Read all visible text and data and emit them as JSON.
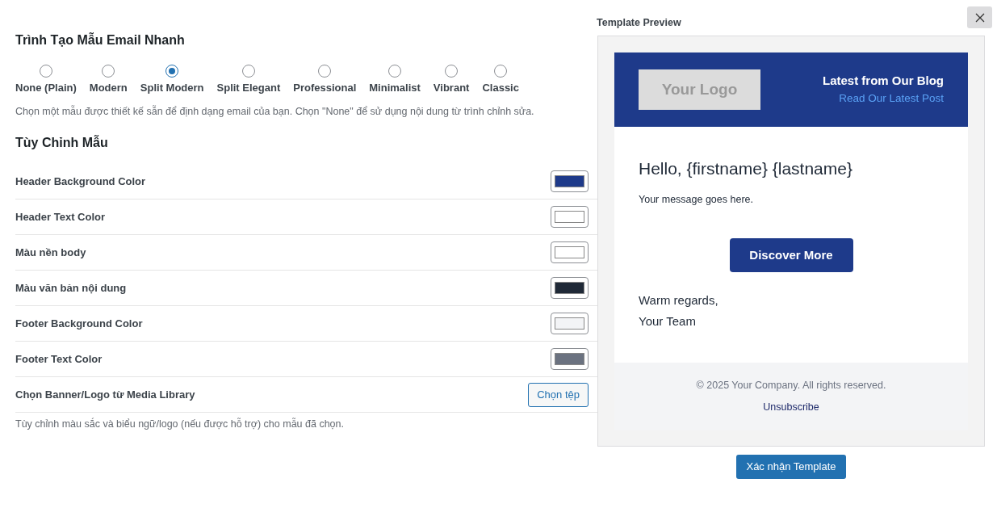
{
  "title": "Trình Tạo Mẫu Email Nhanh",
  "templates": [
    {
      "label": "None (Plain)",
      "selected": false
    },
    {
      "label": "Modern",
      "selected": false
    },
    {
      "label": "Split Modern",
      "selected": true
    },
    {
      "label": "Split Elegant",
      "selected": false
    },
    {
      "label": "Professional",
      "selected": false
    },
    {
      "label": "Minimalist",
      "selected": false
    },
    {
      "label": "Vibrant",
      "selected": false
    },
    {
      "label": "Classic",
      "selected": false
    }
  ],
  "templates_hint": "Chọn một mẫu được thiết kế sẵn để định dạng email của bạn. Chọn \"None\" để sử dụng nội dung từ trình chỉnh sửa.",
  "customize_title": "Tùy Chỉnh Mẫu",
  "settings": [
    {
      "kind": "color",
      "label": "Header Background Color",
      "color": "#1e3a8a"
    },
    {
      "kind": "color",
      "label": "Header Text Color",
      "color": "#ffffff"
    },
    {
      "kind": "color",
      "label": "Màu nền body",
      "color": "#ffffff"
    },
    {
      "kind": "color",
      "label": "Màu văn bản nội dung",
      "color": "#1f2937"
    },
    {
      "kind": "color",
      "label": "Footer Background Color",
      "color": "#f3f4f6"
    },
    {
      "kind": "color",
      "label": "Footer Text Color",
      "color": "#6b7280"
    },
    {
      "kind": "file",
      "label": "Chọn Banner/Logo từ Media Library",
      "button": "Chọn tệp"
    }
  ],
  "customize_hint": "Tùy chỉnh màu sắc và biểu ngữ/logo (nếu được hỗ trợ) cho mẫu đã chọn.",
  "preview": {
    "title": "Template Preview",
    "logo": "Your Logo",
    "blog_title": "Latest from Our Blog",
    "blog_link": "Read Our Latest Post",
    "greeting": "Hello, {firstname} {lastname}",
    "message": "Your message goes here.",
    "cta": "Discover More",
    "closing": [
      "Warm regards,",
      "Your Team"
    ],
    "copyright": "© 2025 Your Company. All rights reserved.",
    "unsubscribe": "Unsubscribe"
  },
  "confirm_button": "Xác nhận Template"
}
